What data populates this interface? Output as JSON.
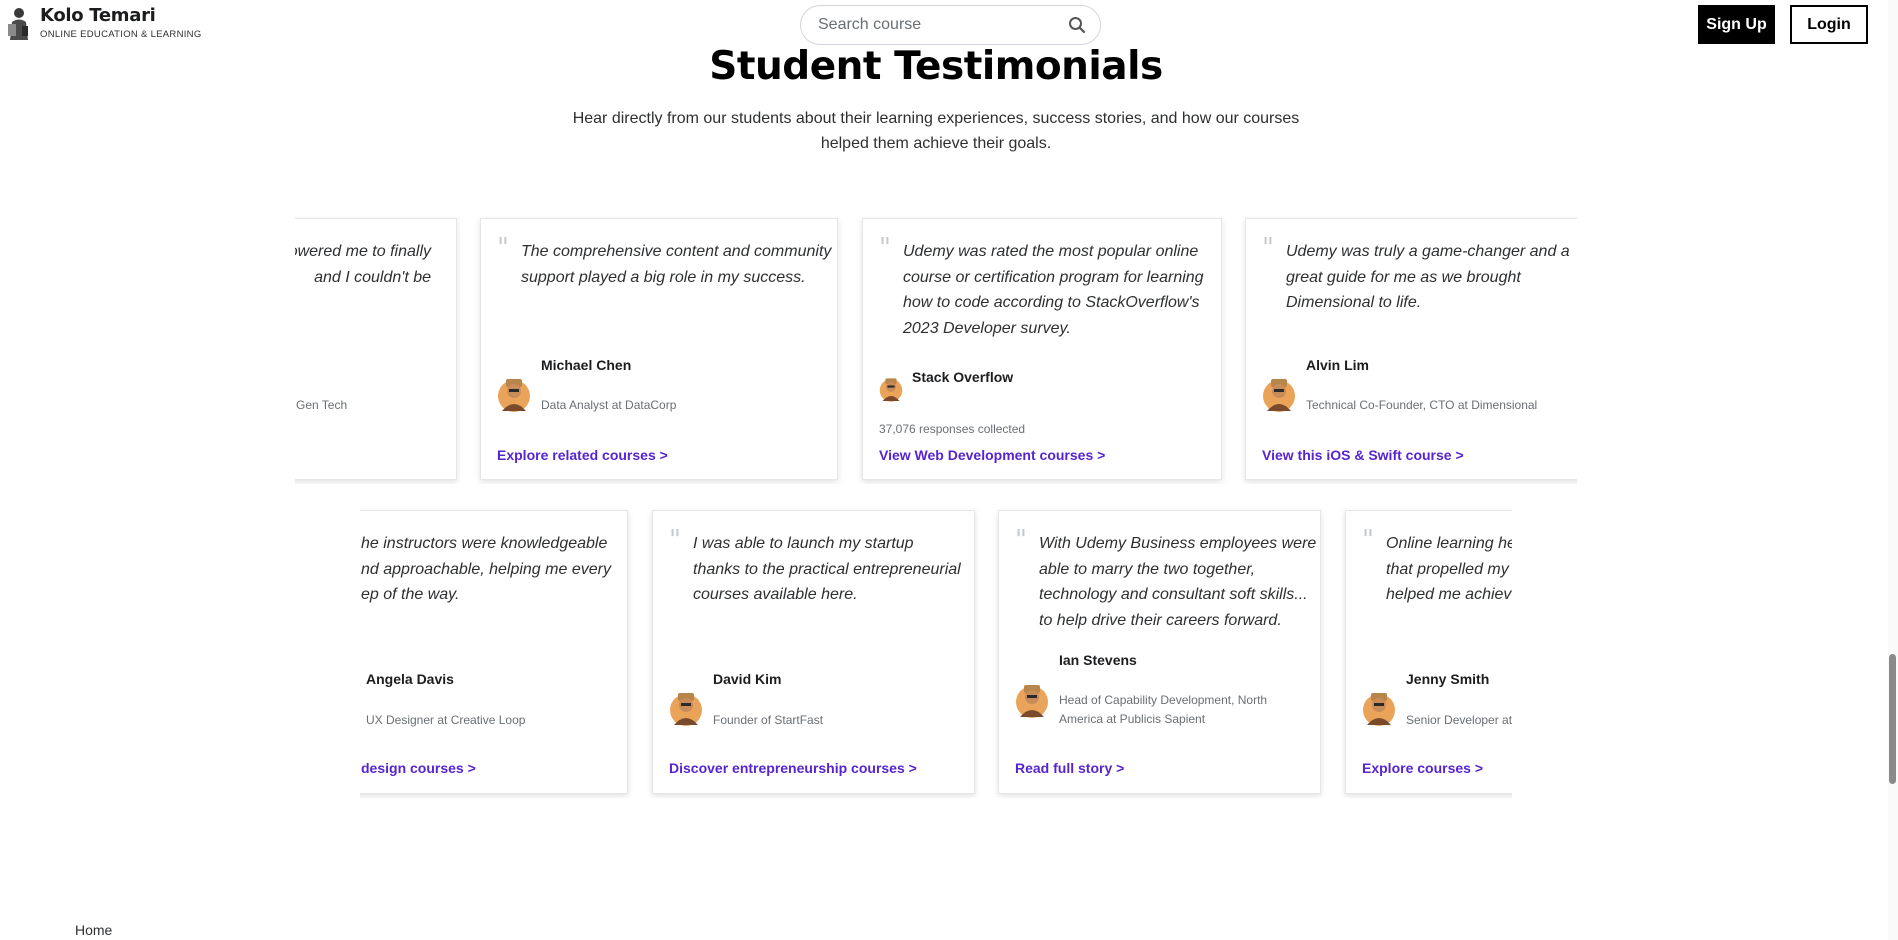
{
  "header": {
    "logo_title": "Kolo Temari",
    "logo_subtitle": "ONLINE EDUCATION & LEARNING",
    "search_placeholder": "Search course",
    "signup_label": "Sign Up",
    "login_label": "Login"
  },
  "section": {
    "title": "Student Testimonials",
    "subtitle_line1": "Hear directly from our students about their learning experiences, success stories, and how our courses",
    "subtitle_line2": "helped them achieve their goals."
  },
  "row1": [
    {
      "quote_lines": [
        "owered me to finally",
        " and I couldn't be"
      ],
      "name": "",
      "role": "Gen Tech",
      "link": ""
    },
    {
      "quote_lines": [
        "The comprehensive content and community",
        "support played a big role in my success."
      ],
      "name": "Michael Chen",
      "role": "Data Analyst at DataCorp",
      "link": "Explore related courses >"
    },
    {
      "quote_lines": [
        "Udemy was rated the most popular online",
        "course or certification program for learning",
        "how to code according to StackOverflow's",
        "2023 Developer survey."
      ],
      "name": "Stack Overflow",
      "meta": "37,076 responses collected",
      "link": "View Web Development courses >"
    },
    {
      "quote_lines": [
        "Udemy was truly a game-changer and a",
        "great guide for me as we brought",
        "Dimensional to life."
      ],
      "name": "Alvin Lim",
      "role": "Technical Co-Founder, CTO at Dimensional",
      "link": "View this iOS & Swift course >"
    }
  ],
  "row2": [
    {
      "quote_lines": [
        "he instructors were knowledgeable",
        "nd approachable, helping me every",
        "ep of the way."
      ],
      "name": "Angela Davis",
      "role": "UX Designer at Creative Loop",
      "link": "design courses >"
    },
    {
      "quote_lines": [
        "I was able to launch my startup",
        "thanks to the practical entrepreneurial",
        "courses available here."
      ],
      "name": "David Kim",
      "role": "Founder of StartFast",
      "link": "Discover entrepreneurship courses >"
    },
    {
      "quote_lines": [
        "With Udemy Business employees were",
        "able to marry the two together,",
        "technology and consultant soft skills...",
        "to help drive their careers forward."
      ],
      "name": "Ian Stevens",
      "role_line1": "Head of Capability Development, North",
      "role_line2": "America at Publicis Sapient",
      "link": "Read full story >"
    },
    {
      "quote_lines": [
        "Online learning he",
        "that propelled my",
        "helped me achieve"
      ],
      "name": "Jenny Smith",
      "role": "Senior Developer at",
      "link": "Explore courses >"
    }
  ],
  "footer": {
    "home_label": "Home"
  },
  "colors": {
    "link": "#5624d0",
    "text": "#1c1d1f",
    "muted": "#6a6f73"
  }
}
